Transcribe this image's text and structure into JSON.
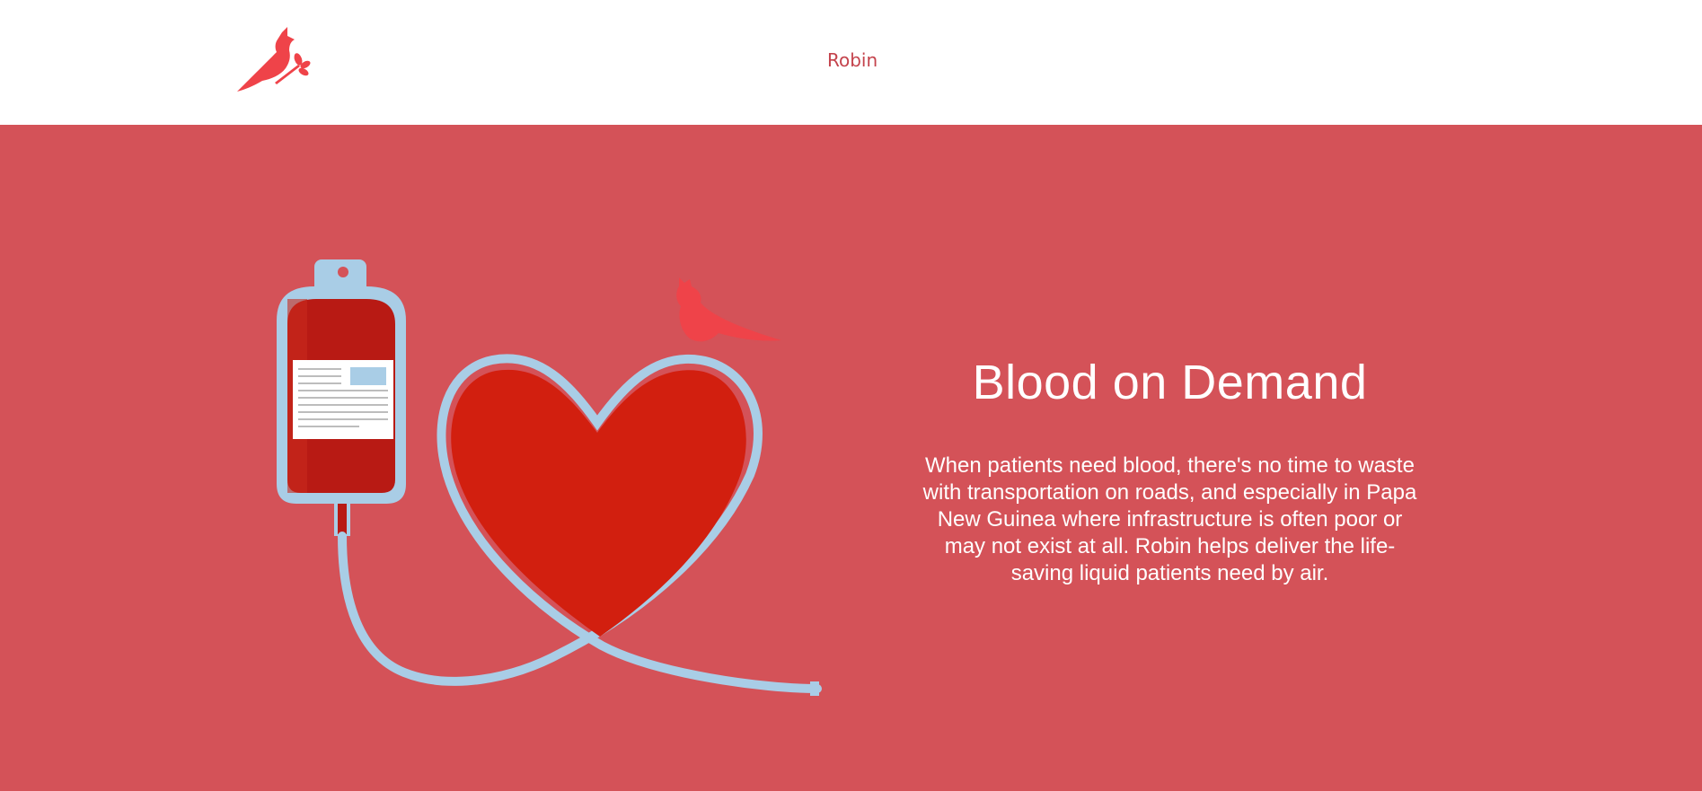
{
  "header": {
    "brand_name": "Robin",
    "logo_icon": "cardinal-bird-icon"
  },
  "hero": {
    "title": "Blood on Demand",
    "body": "When patients need blood, there's no time to waste with transportation on roads, and especially in Papa New Guinea where infrastructure is often poor or may not exist at all. Robin helps deliver the life-saving liquid patients need by air.",
    "illustration_icons": [
      "blood-bag-icon",
      "heart-tube-icon",
      "cardinal-bird-icon"
    ]
  },
  "colors": {
    "hero_background": "#d45258",
    "brand_red": "#ef4349",
    "brand_link": "#c4434c",
    "heart_red": "#d21f0f",
    "bag_red": "#b81a14",
    "tube_blue": "#a9cde6",
    "text_white": "#ffffff"
  }
}
